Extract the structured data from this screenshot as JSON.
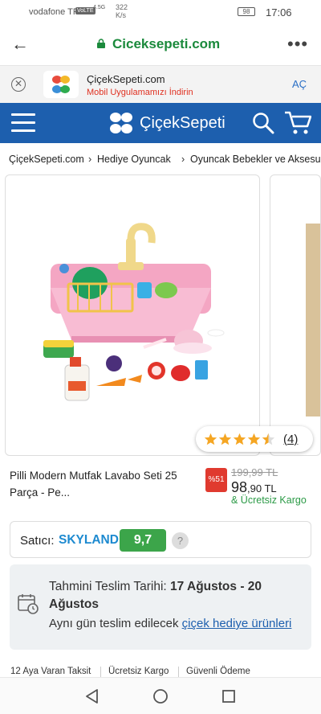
{
  "status_bar": {
    "carrier": "vodafone TR",
    "volte": "VoLTE",
    "network": "4.5G",
    "speed": "322",
    "speed_unit": "K/s",
    "battery": "98",
    "time": "17:06"
  },
  "browser": {
    "domain": "Ciceksepeti.com",
    "back_icon": "arrow-left-icon",
    "menu_icon": "more-vert-icon"
  },
  "app_banner": {
    "title": "ÇiçekSepeti.com",
    "subtitle": "Mobil Uygulamamızı İndirin",
    "open_label": "AÇ"
  },
  "header": {
    "brand": "ÇiçekSepeti",
    "brand_color": "#1d5fae"
  },
  "breadcrumb": {
    "items": [
      "ÇiçekSepeti.com",
      "Hediye Oyuncak",
      "Oyuncak Bebekler ve Aksesu"
    ]
  },
  "product": {
    "name": "Pilli Modern Mutfak Lavabo Seti 25 Parça - Pe...",
    "rating": 4.5,
    "review_count": "(4)",
    "discount": "%51",
    "old_price": "199,99 TL",
    "price_main": "98",
    "price_fraction": ",90 TL",
    "shipping": "& Ücretsiz Kargo"
  },
  "seller": {
    "label": "Satıcı:",
    "name": "SKYLAND",
    "score": "9,7",
    "help": "?"
  },
  "delivery": {
    "label": "Tahmini Teslim Tarihi:",
    "dates": "17 Ağustos - 20 Ağustos",
    "same_day_prefix": "Aynı gün teslim edilecek",
    "same_day_link": "çiçek hediye ürünleri"
  },
  "features": [
    "12 Aya Varan Taksit",
    "Ücretsiz Kargo",
    "Güvenli Ödeme"
  ]
}
